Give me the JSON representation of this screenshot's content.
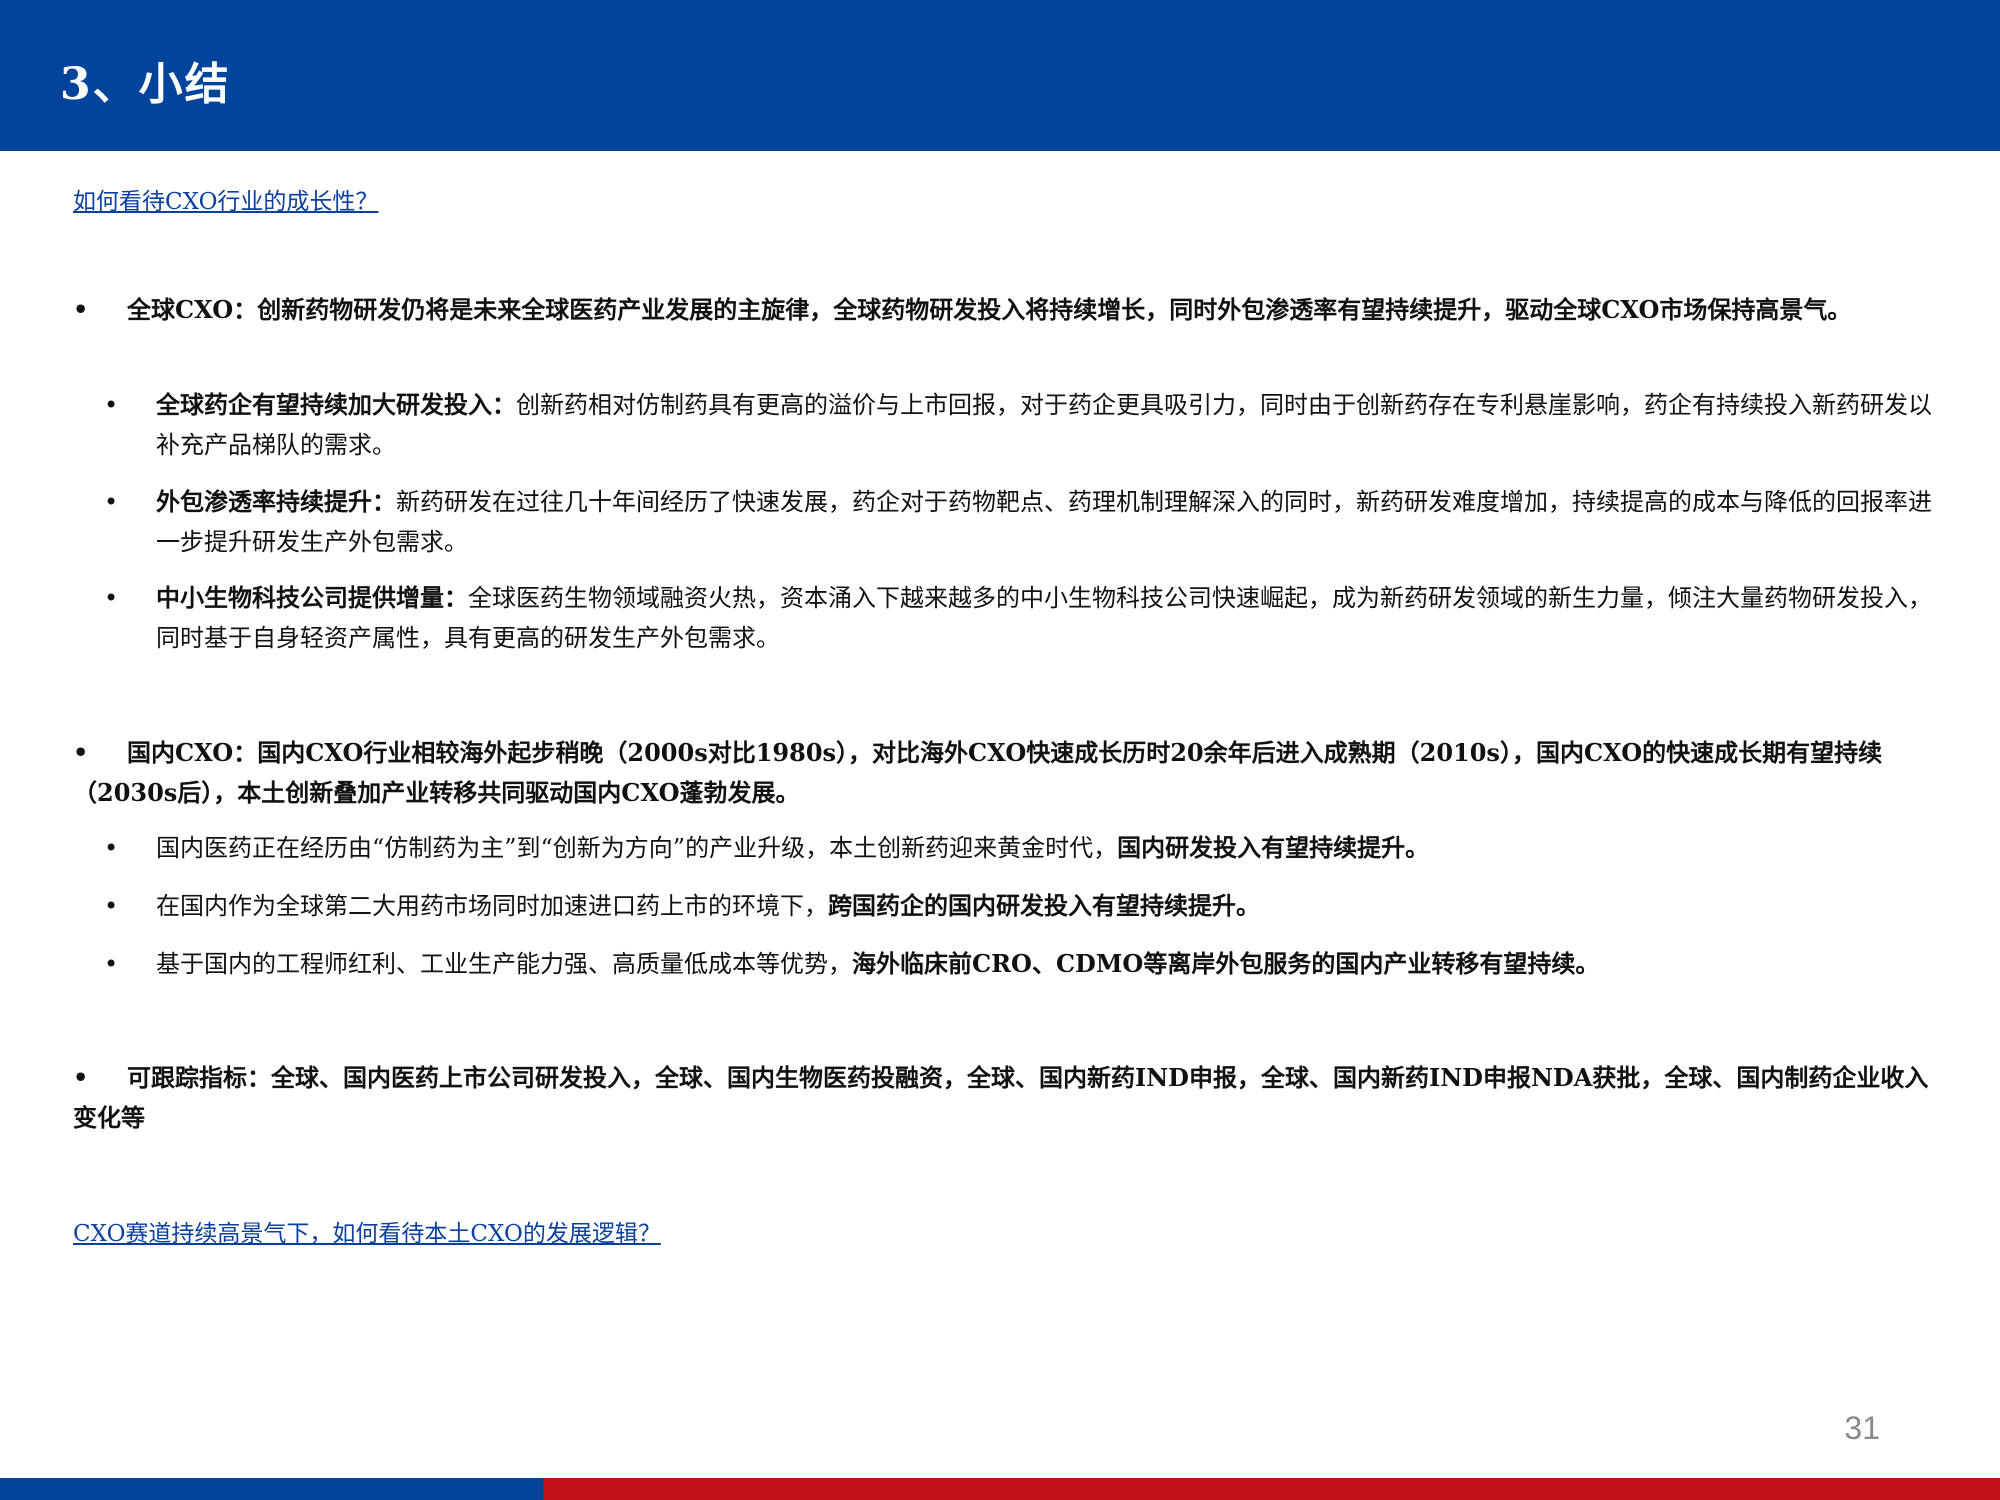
{
  "header": {
    "title": "3、小结"
  },
  "questions": {
    "q1": "如何看待CXO行业的成长性？",
    "q2": "CXO赛道持续高景气下，如何看待本土CXO的发展逻辑？"
  },
  "global": {
    "bullet": "•",
    "lead": "全球CXO：创新药物研发仍将是未来全球医药产业发展的主旋律，全球药物研发投入将持续增长，同时外包渗透率有望持续提升，驱动全球CXO市场保持高景气。",
    "items": [
      {
        "bold": "全球药企有望持续加大研发投入：",
        "text": "创新药相对仿制药具有更高的溢价与上市回报，对于药企更具吸引力，同时由于创新药存在专利悬崖影响，药企有持续投入新药研发以补充产品梯队的需求。"
      },
      {
        "bold": "外包渗透率持续提升：",
        "text": "新药研发在过往几十年间经历了快速发展，药企对于药物靶点、药理机制理解深入的同时，新药研发难度增加，持续提高的成本与降低的回报率进一步提升研发生产外包需求。"
      },
      {
        "bold": "中小生物科技公司提供增量：",
        "text": "全球医药生物领域融资火热，资本涌入下越来越多的中小生物科技公司快速崛起，成为新药研发领域的新生力量，倾注大量药物研发投入，同时基于自身轻资产属性，具有更高的研发生产外包需求。"
      }
    ]
  },
  "domestic": {
    "bullet": "•",
    "lead": "国内CXO：国内CXO行业相较海外起步稍晚（2000s对比1980s），对比海外CXO快速成长历时20余年后进入成熟期（2010s），国内CXO的快速成长期有望持续（2030s后），本土创新叠加产业转移共同驱动国内CXO蓬勃发展。",
    "items": [
      {
        "text": "国内医药正在经历由“仿制药为主”到“创新为方向”的产业升级，本土创新药迎来黄金时代，",
        "bold": "国内研发投入有望持续提升。"
      },
      {
        "text": "在国内作为全球第二大用药市场同时加速进口药上市的环境下，",
        "bold": "跨国药企的国内研发投入有望持续提升。"
      },
      {
        "text": "基于国内的工程师红利、工业生产能力强、高质量低成本等优势，",
        "bold": "海外临床前CRO、CDMO等离岸外包服务的国内产业转移有望持续。"
      }
    ]
  },
  "tracking": {
    "bullet": "•",
    "lead": "可跟踪指标：全球、国内医药上市公司研发投入，全球、国内生物医药投融资，全球、国内新药IND申报，全球、国内新药IND申报NDA获批，全球、国内制药企业收入变化等"
  },
  "page_number": "31",
  "colors": {
    "brand_blue": "#00449b",
    "brand_red": "#c0101a",
    "link_blue": "#0b3fa0"
  }
}
